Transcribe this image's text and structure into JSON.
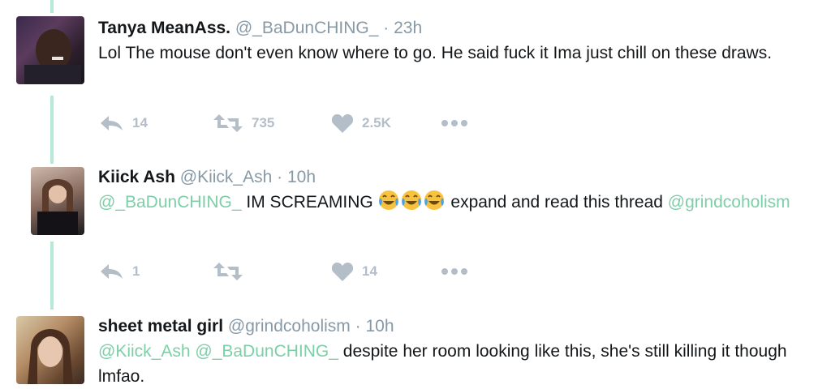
{
  "tweets": [
    {
      "name": "Tanya MeanAss.",
      "handle": "@_BaDunCHING_",
      "sep": "·",
      "time": "23h",
      "text": "Lol The mouse don't even know where to go. He said fuck it Ima just chill on these draws.",
      "reply_count": "14",
      "retweet_count": "735",
      "like_count": "2.5K"
    },
    {
      "name": "Kiick Ash",
      "handle": "@Kiick_Ash",
      "sep": "·",
      "time": "10h",
      "mention1": "@_BaDunCHING_",
      "text_a": " IM SCREAMING ",
      "emojis": [
        "face-with-tears-of-joy",
        "face-with-tears-of-joy",
        "face-with-tears-of-joy"
      ],
      "text_b": " expand and read this thread ",
      "mention2": "@grindcoholism",
      "reply_count": "1",
      "retweet_count": "",
      "like_count": "14"
    },
    {
      "name": "sheet metal girl",
      "handle": "@grindcoholism",
      "sep": "·",
      "time": "10h",
      "mention1": "@Kiick_Ash",
      "mention2": "@_BaDunCHING_",
      "text": " despite her room looking like this, she's still killing it though lmfao."
    }
  ],
  "icons": {
    "reply": "reply-arrow-icon",
    "retweet": "retweet-icon",
    "like": "heart-icon",
    "more": "more-dots-icon"
  },
  "colors": {
    "mention": "#7ccfa7",
    "thread_line": "#b6ead4",
    "muted": "#8899a6",
    "action": "#b3bec8"
  }
}
